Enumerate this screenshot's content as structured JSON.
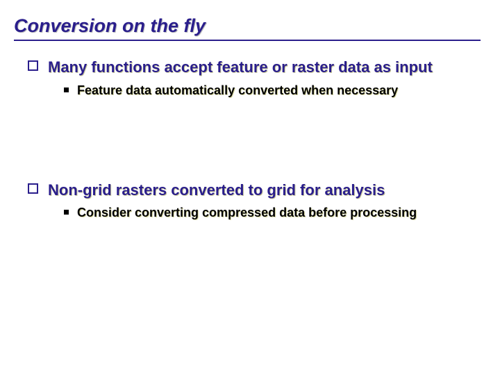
{
  "slide": {
    "title": "Conversion on the fly",
    "bullets": [
      {
        "level": 1,
        "text": "Many functions accept feature or raster data as input"
      },
      {
        "level": 2,
        "text": "Feature data automatically converted when necessary"
      },
      {
        "level": 1,
        "text": "Non-grid rasters converted to grid for analysis"
      },
      {
        "level": 2,
        "text": "Consider converting compressed data before processing"
      }
    ]
  }
}
